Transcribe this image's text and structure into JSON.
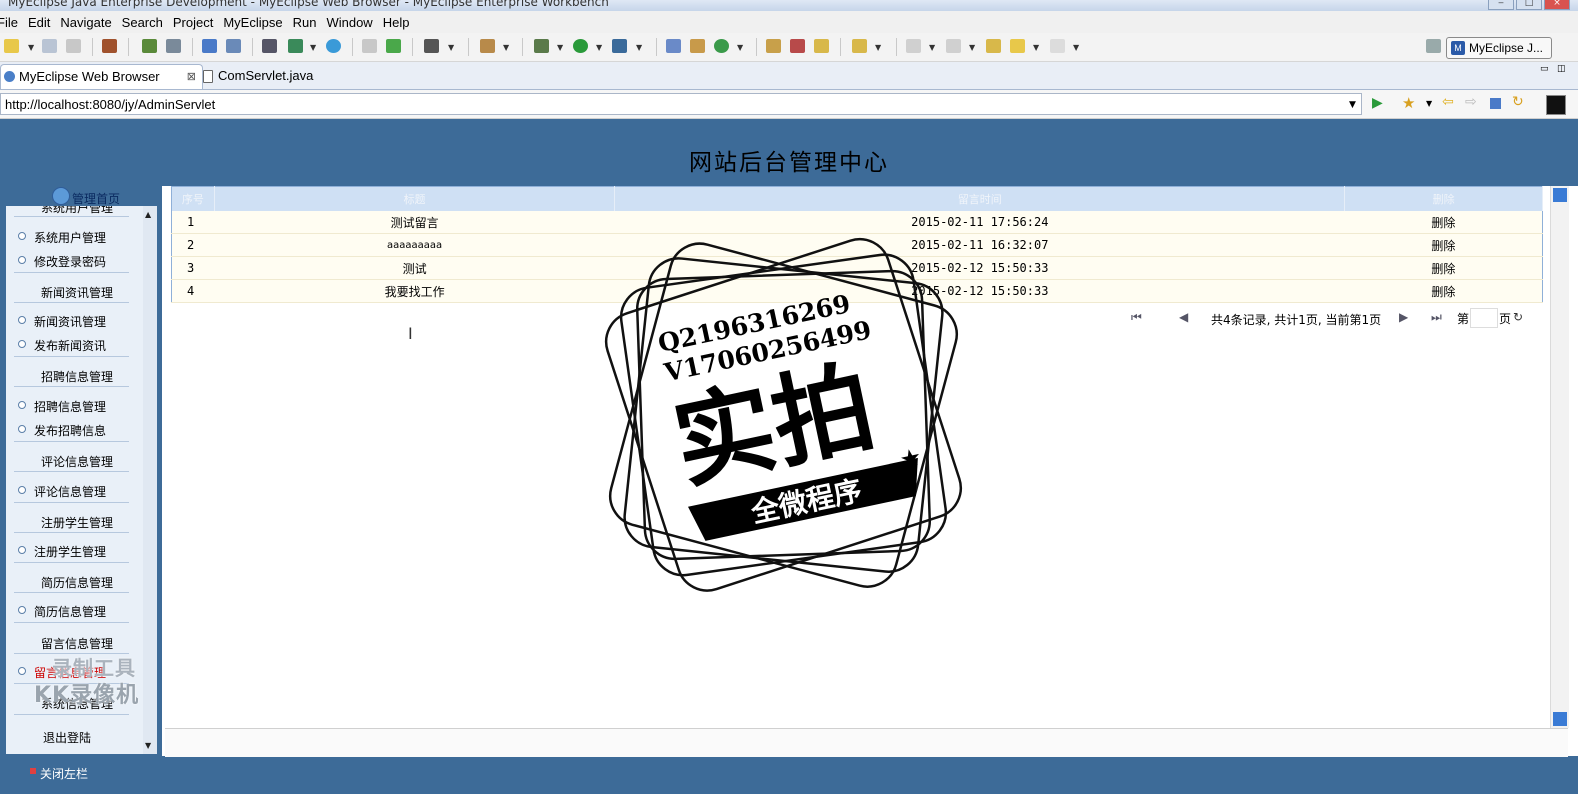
{
  "window": {
    "title": "MyEclipse Java Enterprise Development - MyEclipse Web Browser - MyEclipse Enterprise Workbench"
  },
  "menu": [
    "File",
    "Edit",
    "Navigate",
    "Search",
    "Project",
    "MyEclipse",
    "Run",
    "Window",
    "Help"
  ],
  "perspective": {
    "label": "MyEclipse J..."
  },
  "tabs": [
    {
      "label": "MyEclipse Web Browser",
      "closable": true
    },
    {
      "label": "ComServlet.java"
    }
  ],
  "address": {
    "url": "http://localhost:8080/jy/AdminServlet"
  },
  "header": {
    "title": "网站后台管理中心"
  },
  "sidebar": {
    "home": "管理首页",
    "partial_section": "系统用户管理",
    "items": [
      {
        "label": "系统用户管理",
        "type": "item"
      },
      {
        "label": "修改登录密码",
        "type": "item"
      },
      {
        "label": "新闻资讯管理",
        "type": "section"
      },
      {
        "label": "新闻资讯管理",
        "type": "item"
      },
      {
        "label": "发布新闻资讯",
        "type": "item"
      },
      {
        "label": "招聘信息管理",
        "type": "section"
      },
      {
        "label": "招聘信息管理",
        "type": "item"
      },
      {
        "label": "发布招聘信息",
        "type": "item"
      },
      {
        "label": "评论信息管理",
        "type": "section"
      },
      {
        "label": "评论信息管理",
        "type": "item"
      },
      {
        "label": "注册学生管理",
        "type": "section"
      },
      {
        "label": "注册学生管理",
        "type": "item"
      },
      {
        "label": "简历信息管理",
        "type": "section"
      },
      {
        "label": "简历信息管理",
        "type": "item"
      },
      {
        "label": "留言信息管理",
        "type": "section"
      },
      {
        "label": "留言信息管理",
        "type": "item"
      },
      {
        "label": "系统信息管理",
        "type": "section"
      },
      {
        "label": "退出登陆",
        "type": "section"
      }
    ],
    "close_label": "关闭左栏"
  },
  "table": {
    "headers": [
      "序号",
      "标题",
      "留言时间",
      "删除"
    ],
    "rows": [
      {
        "no": "1",
        "title": "测试留言",
        "time": "2015-02-11 17:56:24",
        "action": "删除"
      },
      {
        "no": "2",
        "title": "aaaaaaaaa",
        "time": "2015-02-11 16:32:07",
        "action": "删除"
      },
      {
        "no": "3",
        "title": "测试",
        "time": "2015-02-12 15:50:33",
        "action": "删除"
      },
      {
        "no": "4",
        "title": "我要找工作",
        "time": "2015-02-12 15:50:33",
        "action": "删除"
      }
    ]
  },
  "pager": {
    "summary": "共4条记录, 共计1页, 当前第1页",
    "page_prefix": "第",
    "page_suffix": "页"
  },
  "watermark": {
    "line1": "Q2196316269",
    "line2": "V17060256499",
    "big": "实拍",
    "ribbon": "全微程序"
  },
  "recorder": {
    "line1": "录制工具",
    "line2": "KK录像机"
  },
  "colors": {
    "header_bg": "#3d6b98",
    "sidebar_bg": "#e9f0f8",
    "table_header": "#cfe0f4",
    "row_bg": "#fffdf2"
  }
}
